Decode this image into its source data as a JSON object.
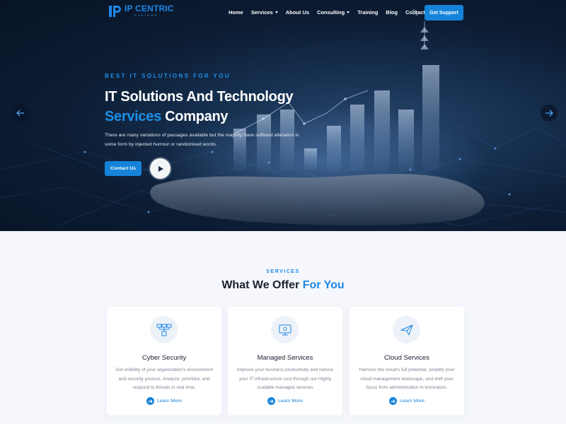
{
  "brand": {
    "name": "IP CENTRIC",
    "tagline": "SYSTEMS"
  },
  "nav": {
    "items": [
      {
        "label": "Home",
        "dropdown": false
      },
      {
        "label": "Services",
        "dropdown": true
      },
      {
        "label": "About Us",
        "dropdown": false
      },
      {
        "label": "Consulting",
        "dropdown": true
      },
      {
        "label": "Training",
        "dropdown": false
      },
      {
        "label": "Blog",
        "dropdown": false
      },
      {
        "label": "Contact",
        "dropdown": false
      }
    ],
    "cta_label": "Get Support"
  },
  "hero": {
    "eyebrow": "BEST IT SOLUTIONS FOR YOU",
    "title_line1": "IT Solutions And Technology",
    "title_accent": "Services",
    "title_rest": " Company",
    "description": "There are many variations of passages available but the majority have suffered alteration in some form by injected humour or randomised words.",
    "cta_label": "Contact Us"
  },
  "services": {
    "label": "SERVICES",
    "title_main": "What We Offer ",
    "title_accent": "For You",
    "cards": [
      {
        "icon": "network-icon",
        "title": "Cyber Security",
        "description": "Get visibility of your organization's environment and security posture. Analyze, prioritize, and respond to threats in real time.",
        "link": "Learn More"
      },
      {
        "icon": "monitor-icon",
        "title": "Managed Services",
        "description": "Improve your business productivity and reduce your IT infrastructure cost through our Highly scalable managed services",
        "link": "Learn More"
      },
      {
        "icon": "paper-plane-icon",
        "title": "Cloud Services",
        "description": "Harness the cloud's full potential, simplify your cloud management landscape, and shift your focus from administration to innovation.",
        "link": "Learn More"
      }
    ]
  },
  "colors": {
    "accent": "#1583d9",
    "hero_bg": "#0c1c33",
    "page_bg": "#f5f7fc"
  }
}
